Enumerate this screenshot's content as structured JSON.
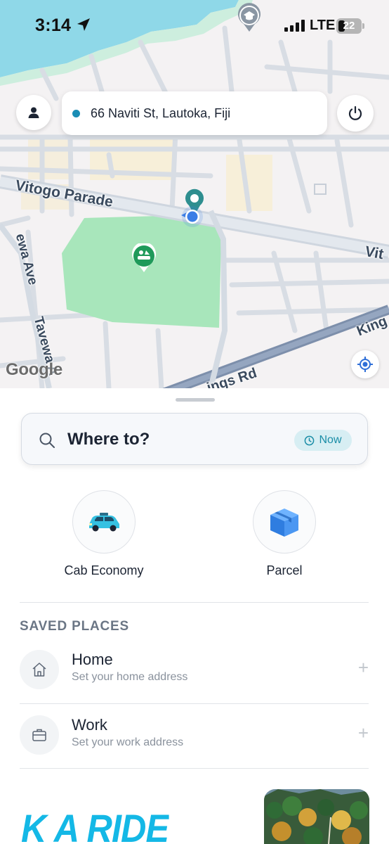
{
  "status_bar": {
    "time": "3:14",
    "network": "LTE",
    "battery": "22",
    "icons": [
      "location-arrow-icon",
      "signal-icon",
      "battery-icon"
    ]
  },
  "map": {
    "address": "66 Naviti St, Lautoka, Fiji",
    "road_labels": {
      "vitogo_parade": "Vitogo Parade",
      "vitogo_parade_right": "Vit",
      "tavewa_ave_left": "ewa Ave",
      "tavewa_ave": "Tavewa A",
      "kings_rd": "ings Rd",
      "kings_rd_right": "King"
    },
    "google_logo": "Google",
    "icons": [
      "user-icon",
      "power-icon",
      "pin-icon",
      "park-icon",
      "school-icon",
      "crosshair-icon"
    ]
  },
  "sheet": {
    "search": {
      "label": "Where to?",
      "time_option": "Now"
    },
    "services": [
      {
        "label": "Cab Economy",
        "icon": "taxi-icon"
      },
      {
        "label": "Parcel",
        "icon": "box-icon"
      }
    ],
    "saved_places": {
      "title": "SAVED PLACES",
      "items": [
        {
          "title": "Home",
          "subtitle": "Set your home address",
          "icon": "home-icon"
        },
        {
          "title": "Work",
          "subtitle": "Set your work address",
          "icon": "briefcase-icon"
        }
      ]
    },
    "promo": {
      "text": "K A RIDE"
    }
  },
  "colors": {
    "accent": "#1a8da7",
    "park": "#a8e6bb",
    "promo": "#14b8e6",
    "route_pin": "#2e8e8f",
    "location_dot": "#3b7de6"
  }
}
